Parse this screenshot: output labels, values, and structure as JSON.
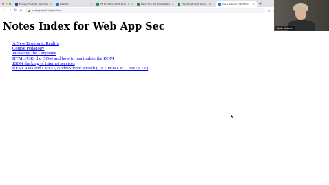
{
  "browser": {
    "tabs": [
      {
        "title": "Fantasy Football | Yahoo! Sp",
        "color": "#6e2b96"
      },
      {
        "title": "Webstat",
        "color": "#1a73e8"
      },
      {
        "title": "TT: Hi Official SVGF Docs - Go",
        "color": "#1e8e3e"
      },
      {
        "title": "Taken Tour: All Time Database",
        "color": "#1e8e3e"
      },
      {
        "title": "The Man Wo SAP Studio - Go",
        "color": "#1e8e3e"
      },
      {
        "title": "Class Notes for CREATSAT",
        "color": "#1a73e8"
      }
    ],
    "active_tab_index": 5,
    "url": "webapp.pmf.ninja/notes/"
  },
  "page": {
    "heading": "Notes Index for Web App Sec",
    "links": [
      "A New Economic Reality",
      "Course Pedagogy",
      "Javascript the Language",
      "HTML/CSS the DOM and how to manipulate the DOM",
      "JSON the king of internet services",
      "REST APIs and CRUD, NodeJS from scratch (GET POST PUT DELETE)"
    ]
  },
  "webcam": {
    "name": "Andy Novocin"
  },
  "colors": {
    "link": "#0000ee",
    "tab_bar": "#dfe1e5",
    "close": "#ff5f57",
    "minimize": "#febc2e",
    "maximize": "#28c840"
  }
}
